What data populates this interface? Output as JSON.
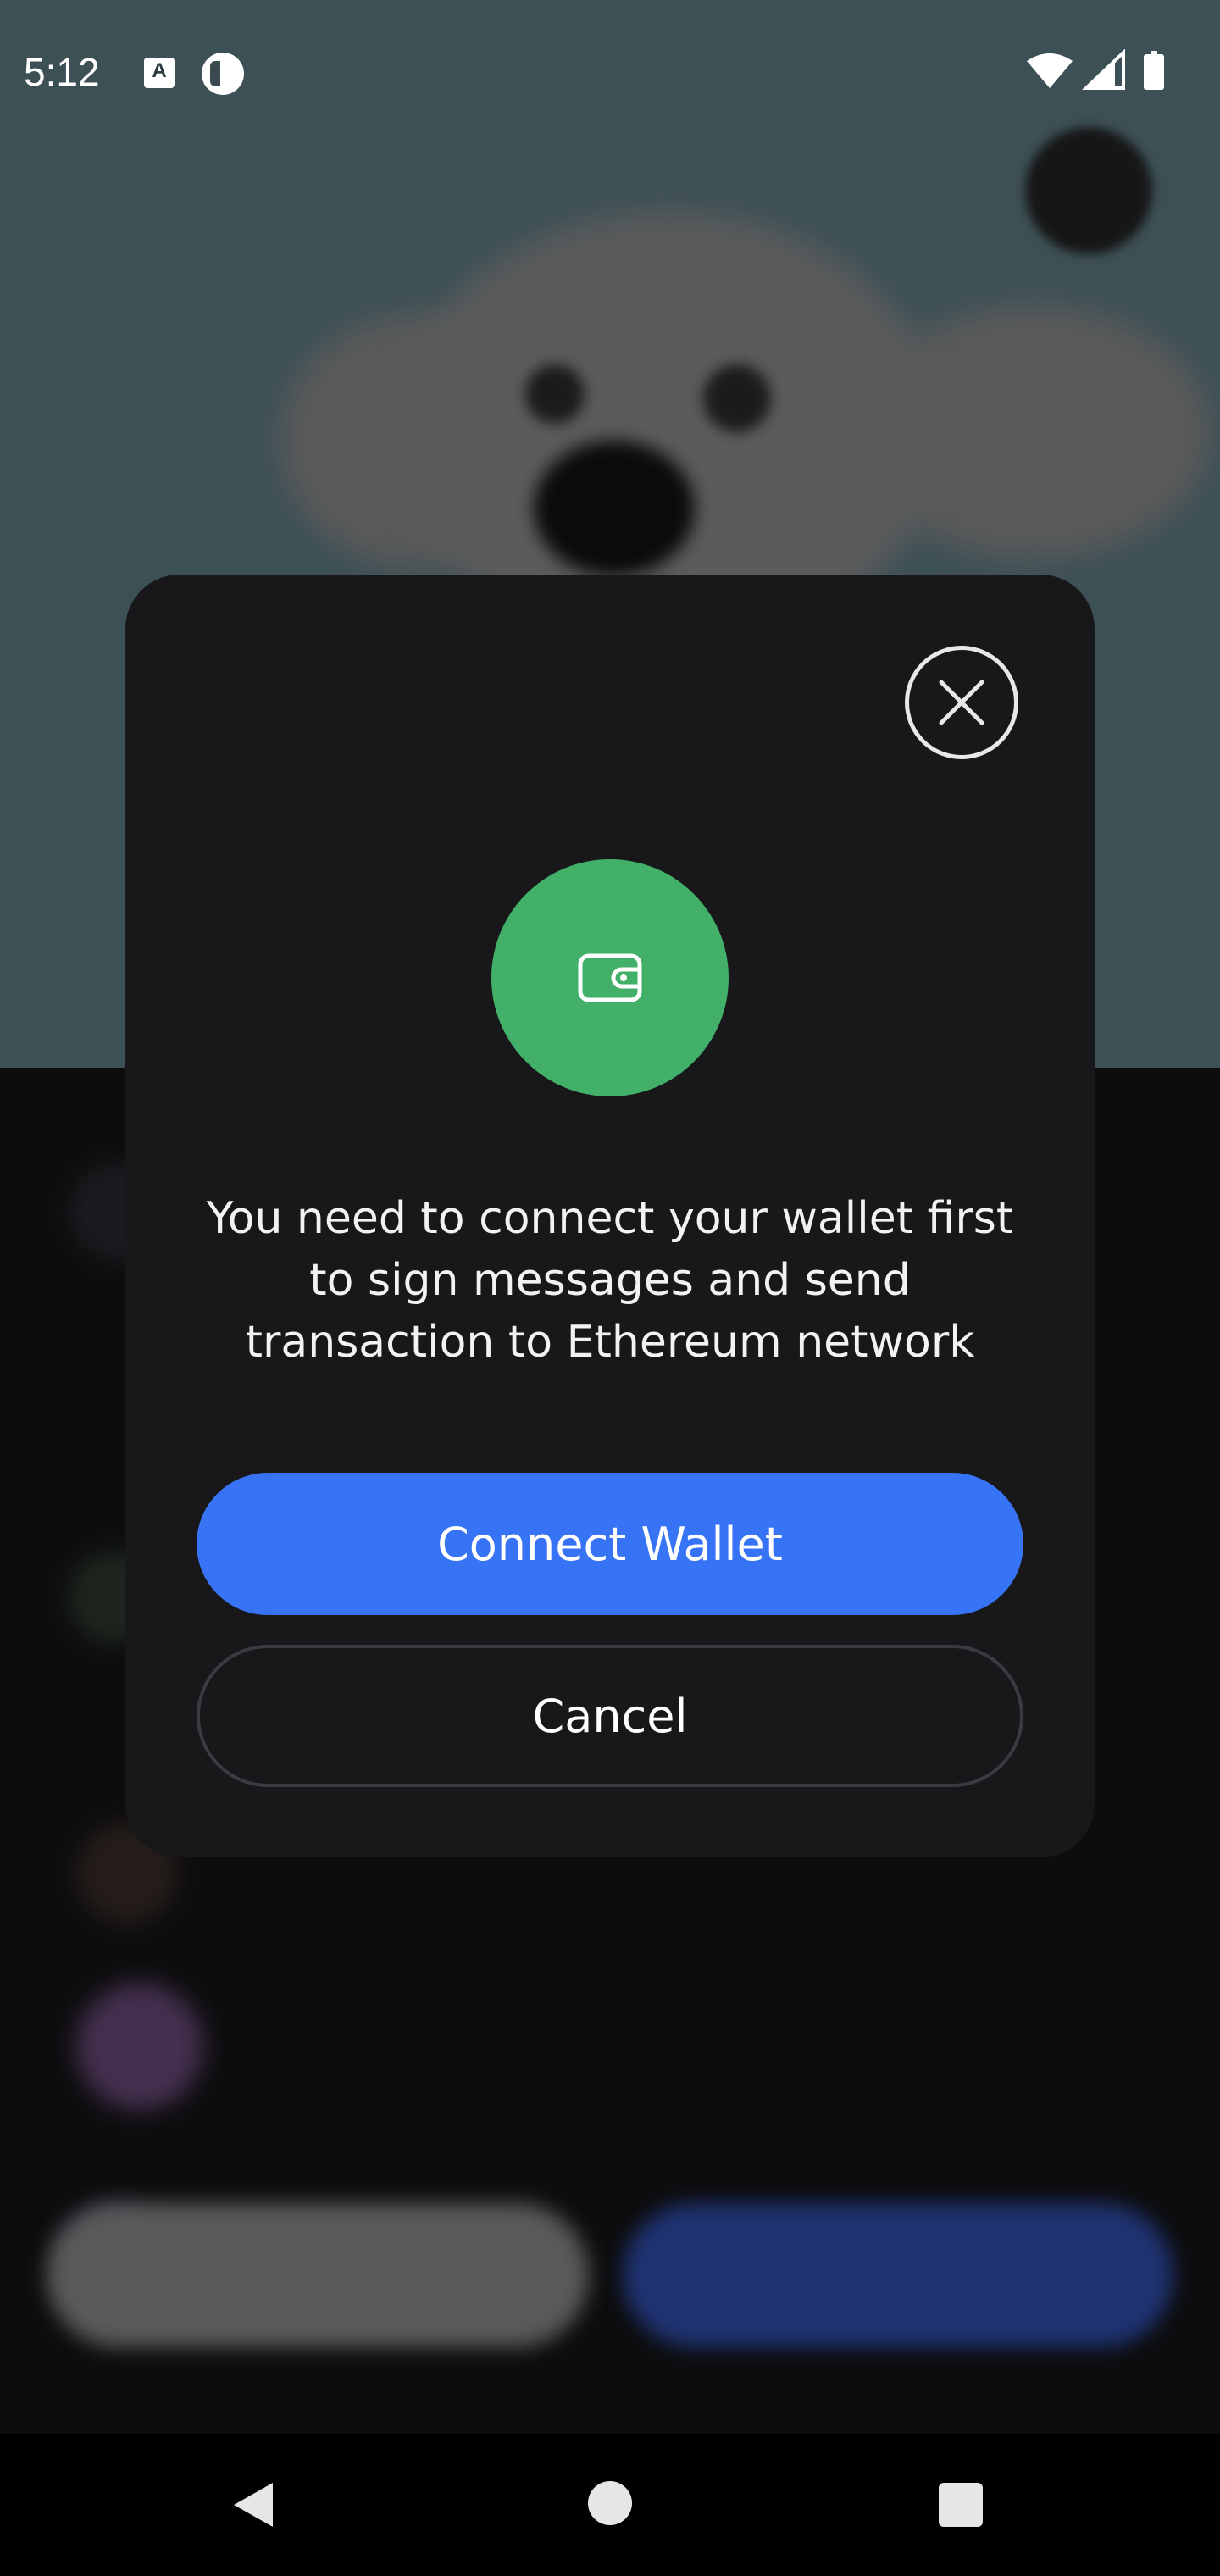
{
  "status_bar": {
    "time": "5:12",
    "icons": [
      "a-notification-icon",
      "app-notification-icon",
      "wifi-icon",
      "cell-signal-icon",
      "battery-icon"
    ]
  },
  "modal": {
    "close_icon": "close-icon",
    "wallet_icon": "wallet-icon",
    "message_line1": "You need to connect your wallet first",
    "message_line2": "to sign messages and send",
    "message_line3": "transaction to Ethereum network",
    "primary_button_label": "Connect Wallet",
    "secondary_button_label": "Cancel"
  },
  "nav_bar": {
    "icons": [
      "back-icon",
      "home-icon",
      "recents-icon"
    ]
  },
  "colors": {
    "accent_blue": "#3773F5",
    "wallet_green": "#43B06A",
    "modal_bg": "#18181B"
  }
}
